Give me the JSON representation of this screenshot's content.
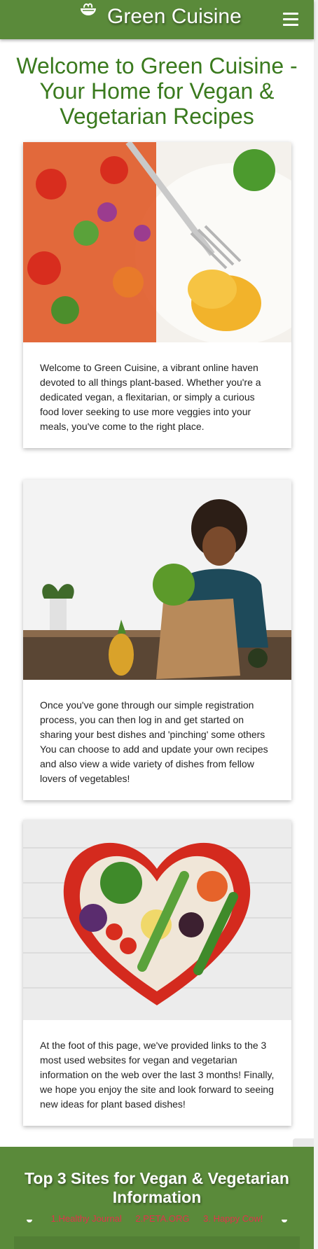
{
  "header": {
    "brand": "Green Cuisine",
    "logo_icon": "salad-bowl-icon",
    "menu_icon": "hamburger-menu-icon"
  },
  "hero": {
    "title": "Welcome to Green Cuisine - Your Home for Vegan & Vegetarian Recipes"
  },
  "cards": [
    {
      "image": "eggs-and-vegetable-salad-photo",
      "text": "Welcome to Green Cuisine, a vibrant online haven devoted to all things plant-based. Whether you're a dedicated vegan, a flexitarian, or simply a curious food lover seeking to use more veggies into your meals, you've come to the right place."
    },
    {
      "image": "woman-unpacking-groceries-photo",
      "text": "Once you've gone through our simple registration process, you can then log in and get started on sharing your best dishes and 'pinching' some others You can choose to add and update your own recipes and also view a wide variety of dishes from fellow lovers of vegetables!"
    },
    {
      "image": "heart-shaped-vegetable-plate-photo",
      "text": "At the foot of this page, we've provided links to the 3 most used websites for vegan and vegetarian information on the web over the last 3 months! Finally, we hope you enjoy the site and look forward to seeing new ideas for plant based dishes!"
    }
  ],
  "footer": {
    "title": "Top 3 Sites for Vegan & Vegetarian Information",
    "links": [
      "1.Healthy Journal",
      "2.PETA.ORG",
      "3. Happy Cow!"
    ]
  },
  "colors": {
    "brand_green": "#5a8a3a",
    "title_green": "#3a7a1e",
    "link_red": "#e0344b"
  }
}
